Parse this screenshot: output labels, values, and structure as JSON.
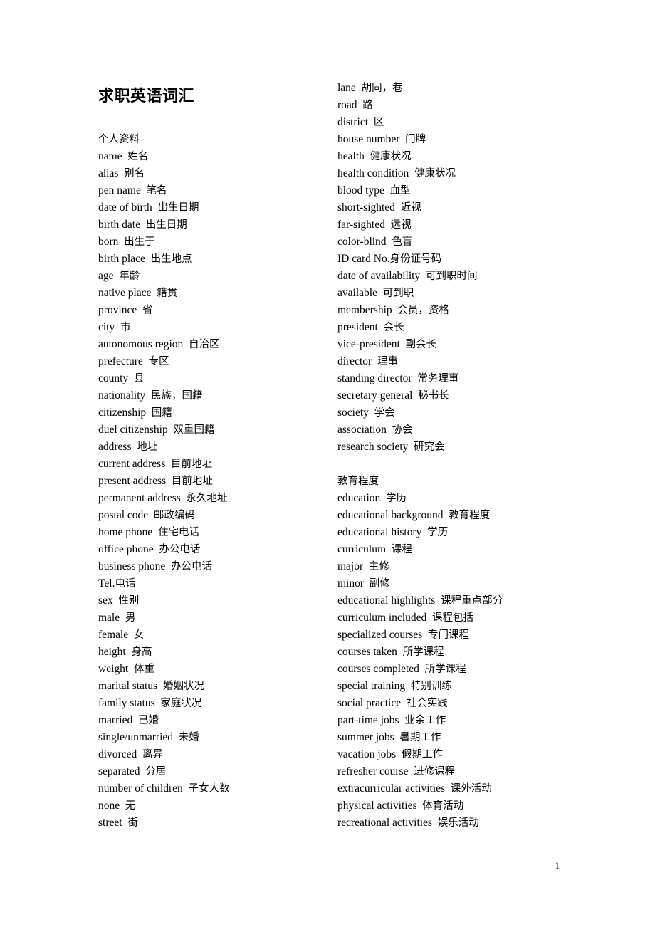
{
  "document": {
    "title": "求职英语词汇",
    "page_number": "1",
    "left_column": [
      {
        "en": "",
        "zh": "个人资料"
      },
      {
        "en": "name",
        "zh": "姓名"
      },
      {
        "en": "alias",
        "zh": "别名"
      },
      {
        "en": "pen name",
        "zh": "笔名"
      },
      {
        "en": "date of birth",
        "zh": "出生日期"
      },
      {
        "en": "birth date",
        "zh": "出生日期"
      },
      {
        "en": "born",
        "zh": "出生于"
      },
      {
        "en": "birth place",
        "zh": "出生地点"
      },
      {
        "en": "age",
        "zh": "年龄"
      },
      {
        "en": "native place",
        "zh": "籍贯"
      },
      {
        "en": "province",
        "zh": "省"
      },
      {
        "en": "city",
        "zh": "市"
      },
      {
        "en": "autonomous region",
        "zh": "自治区"
      },
      {
        "en": "prefecture",
        "zh": "专区"
      },
      {
        "en": "county",
        "zh": "县"
      },
      {
        "en": "nationality",
        "zh": "民族，国籍"
      },
      {
        "en": "citizenship",
        "zh": "国籍"
      },
      {
        "en": "duel citizenship",
        "zh": "双重国籍"
      },
      {
        "en": "address",
        "zh": "地址"
      },
      {
        "en": "current address",
        "zh": "目前地址"
      },
      {
        "en": "present address",
        "zh": "目前地址"
      },
      {
        "en": "permanent address",
        "zh": "永久地址"
      },
      {
        "en": "postal code",
        "zh": "邮政编码"
      },
      {
        "en": "home phone",
        "zh": "住宅电话"
      },
      {
        "en": "office phone",
        "zh": "办公电话"
      },
      {
        "en": "business phone",
        "zh": "办公电话"
      },
      {
        "en": "Tel.",
        "zh": "电话",
        "nospace": true
      },
      {
        "en": "sex",
        "zh": "性别"
      },
      {
        "en": "male",
        "zh": "男"
      },
      {
        "en": "female",
        "zh": "女"
      },
      {
        "en": "height",
        "zh": "身高"
      },
      {
        "en": "weight",
        "zh": "体重"
      },
      {
        "en": "marital status",
        "zh": "婚姻状况"
      },
      {
        "en": "family status",
        "zh": "家庭状况"
      },
      {
        "en": "married",
        "zh": "已婚"
      },
      {
        "en": "single/unmarried",
        "zh": "未婚"
      },
      {
        "en": "divorced",
        "zh": "离异"
      },
      {
        "en": "separated",
        "zh": "分居"
      },
      {
        "en": "number of children",
        "zh": "子女人数"
      },
      {
        "en": "none",
        "zh": "无"
      },
      {
        "en": "street",
        "zh": "街"
      }
    ],
    "right_column": [
      {
        "en": "lane",
        "zh": "胡同，巷"
      },
      {
        "en": "road",
        "zh": "路"
      },
      {
        "en": "district",
        "zh": "区"
      },
      {
        "en": "house number",
        "zh": "门牌"
      },
      {
        "en": "health",
        "zh": "健康状况"
      },
      {
        "en": "health condition",
        "zh": "健康状况"
      },
      {
        "en": "blood type",
        "zh": "血型"
      },
      {
        "en": "short-sighted",
        "zh": "近视"
      },
      {
        "en": "far-sighted",
        "zh": "远视"
      },
      {
        "en": "color-blind",
        "zh": "色盲"
      },
      {
        "en": "ID card No.",
        "zh": "身份证号码",
        "nospace": true
      },
      {
        "en": "date of availability",
        "zh": "可到职时间"
      },
      {
        "en": "available",
        "zh": "可到职"
      },
      {
        "en": "membership",
        "zh": "会员，资格"
      },
      {
        "en": "president",
        "zh": "会长"
      },
      {
        "en": "vice-president",
        "zh": "副会长"
      },
      {
        "en": "director",
        "zh": "理事"
      },
      {
        "en": "standing director",
        "zh": "常务理事"
      },
      {
        "en": "secretary general",
        "zh": "秘书长"
      },
      {
        "en": "society",
        "zh": "学会"
      },
      {
        "en": "association",
        "zh": "协会"
      },
      {
        "en": "research society",
        "zh": "研究会"
      },
      {
        "en": "",
        "zh": "",
        "blank": true
      },
      {
        "en": "",
        "zh": "教育程度"
      },
      {
        "en": "education",
        "zh": "学历"
      },
      {
        "en": "educational background",
        "zh": "教育程度"
      },
      {
        "en": "educational history",
        "zh": "学历"
      },
      {
        "en": "curriculum",
        "zh": "课程"
      },
      {
        "en": "major",
        "zh": "主修"
      },
      {
        "en": "minor",
        "zh": "副修"
      },
      {
        "en": "educational highlights",
        "zh": "课程重点部分"
      },
      {
        "en": "curriculum included",
        "zh": "课程包括"
      },
      {
        "en": "specialized courses",
        "zh": "专门课程"
      },
      {
        "en": "courses taken",
        "zh": "所学课程"
      },
      {
        "en": "courses completed",
        "zh": "所学课程"
      },
      {
        "en": "special training",
        "zh": "特别训练"
      },
      {
        "en": "social practice",
        "zh": "社会实践"
      },
      {
        "en": "part-time jobs",
        "zh": "业余工作"
      },
      {
        "en": "summer jobs",
        "zh": "暑期工作"
      },
      {
        "en": "vacation jobs",
        "zh": "假期工作"
      },
      {
        "en": "refresher course",
        "zh": "进修课程"
      },
      {
        "en": "extracurricular activities",
        "zh": "课外活动"
      },
      {
        "en": "physical activities",
        "zh": "体育活动"
      },
      {
        "en": "recreational activities",
        "zh": "娱乐活动"
      }
    ]
  }
}
